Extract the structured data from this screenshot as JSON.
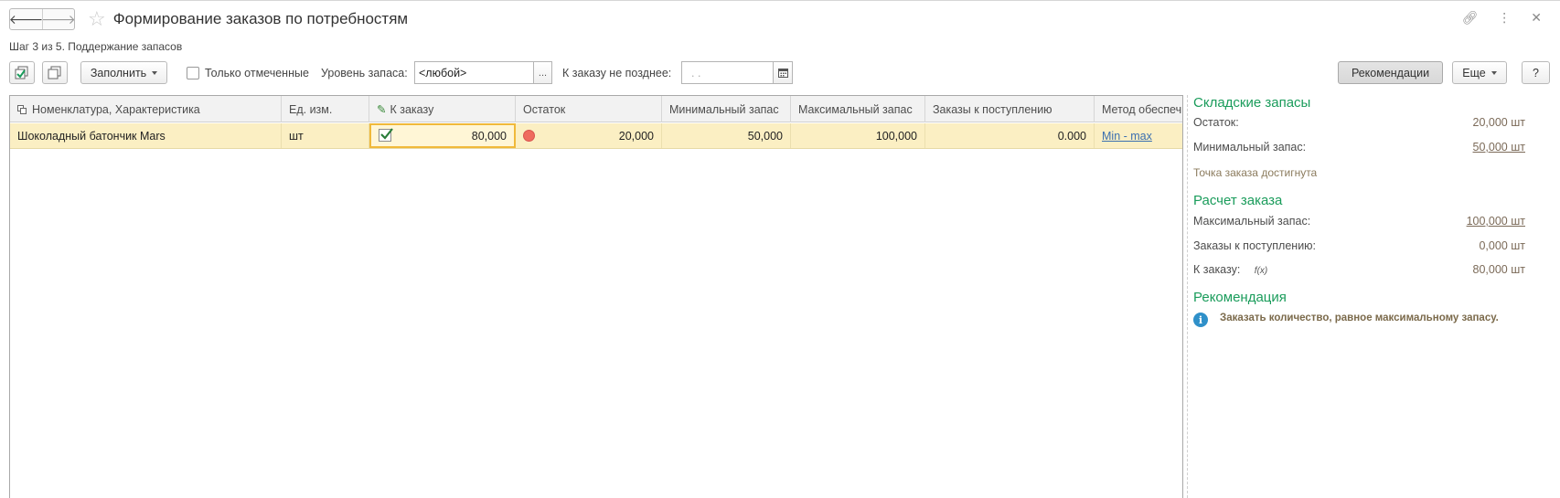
{
  "window": {
    "title": "Формирование заказов по потребностям",
    "step": "Шаг 3 из 5. Поддержание запасов"
  },
  "toolbar": {
    "fill_label": "Заполнить",
    "only_marked_label": "Только отмеченные",
    "stock_level_label": "Уровень запаса:",
    "stock_level_value": "<любой>",
    "select_btn": "...",
    "order_by_label": "К заказу не позднее:",
    "order_by_value": ". .",
    "recommendations_label": "Рекомендации",
    "more_label": "Еще",
    "help_label": "?"
  },
  "table": {
    "columns": [
      "Номенклатура, Характеристика",
      "Ед. изм.",
      "К заказу",
      "Остаток",
      "Минимальный запас",
      "Максимальный запас",
      "Заказы к поступлению",
      "Метод обеспеч"
    ],
    "rows": [
      {
        "item": "Шоколадный батончик Mars",
        "unit": "шт",
        "to_order": "80,000",
        "to_order_checked": true,
        "balance": "20,000",
        "min_stock": "50,000",
        "max_stock": "100,000",
        "incoming": "0.000",
        "method": "Min - max"
      }
    ]
  },
  "panel": {
    "stock_header": "Складские запасы",
    "balance_label": "Остаток:",
    "balance_value": "20,000 шт",
    "min_label": "Минимальный запас:",
    "min_value": "50,000 шт",
    "reorder_note": "Точка заказа достигнута",
    "calc_header": "Расчет заказа",
    "max_label": "Максимальный запас:",
    "max_value": "100,000 шт",
    "incoming_label": "Заказы к поступлению:",
    "incoming_value": "0,000 шт",
    "to_order_label": "К заказу:",
    "to_order_fx": "f(x)",
    "to_order_value": "80,000 шт",
    "rec_header": "Рекомендация",
    "rec_text": "Заказать количество, равное максимальному запасу."
  },
  "colors": {
    "accent_green": "#1a9c5b",
    "row_highlight": "#fbefc3",
    "selected_border": "#f0b93a",
    "status_red": "#ef6b5e",
    "info_blue": "#2f90c9"
  }
}
